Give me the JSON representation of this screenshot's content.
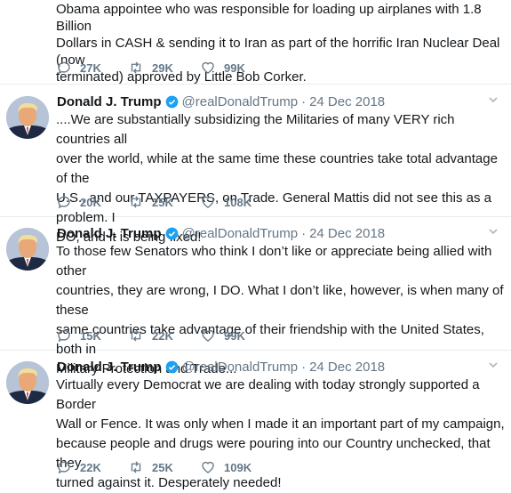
{
  "tweets": [
    {
      "author": "",
      "handle": "",
      "date": "",
      "text": "Obama appointee who was responsible for loading up airplanes with 1.8 Billion\nDollars in CASH &  sending it to Iran as part of the horrific Iran Nuclear Deal (now\nterminated) approved by Little Bob Corker.",
      "replies": "27K",
      "retweets": "29K",
      "likes": "99K"
    },
    {
      "author": "Donald J. Trump",
      "handle": "@realDonaldTrump",
      "date": "24 Dec 2018",
      "text": "....We are substantially subsidizing the Militaries of many VERY rich countries all\nover the world, while at the same time these countries take total advantage of the\nU.S., and our TAXPAYERS, on Trade. General Mattis did not see this as a problem. I\nDO, and it is being fixed!",
      "replies": "20K",
      "retweets": "25K",
      "likes": "108K"
    },
    {
      "author": "Donald J. Trump",
      "handle": "@realDonaldTrump",
      "date": "24 Dec 2018",
      "text": "To those few Senators who think I don’t like or appreciate being allied with other\ncountries, they are wrong, I DO. What I don’t like, however, is when many of these\nsame countries take advantage of their friendship with the United States, both in\nMilitary Protection and Trade...",
      "replies": "15K",
      "retweets": "22K",
      "likes": "99K"
    },
    {
      "author": "Donald J. Trump",
      "handle": "@realDonaldTrump",
      "date": "24 Dec 2018",
      "text": "Virtually every Democrat we are dealing with today strongly supported a Border\nWall or Fence. It was only when I made it an important part of my campaign,\nbecause people and drugs were pouring into our Country unchecked, that they\nturned against it. Desperately needed!",
      "replies": "22K",
      "retweets": "25K",
      "likes": "109K"
    }
  ],
  "separator": "·",
  "colors": {
    "verified": "#1da1f2",
    "muted": "#657786",
    "text": "#14171a",
    "border": "#e6ecf0"
  }
}
